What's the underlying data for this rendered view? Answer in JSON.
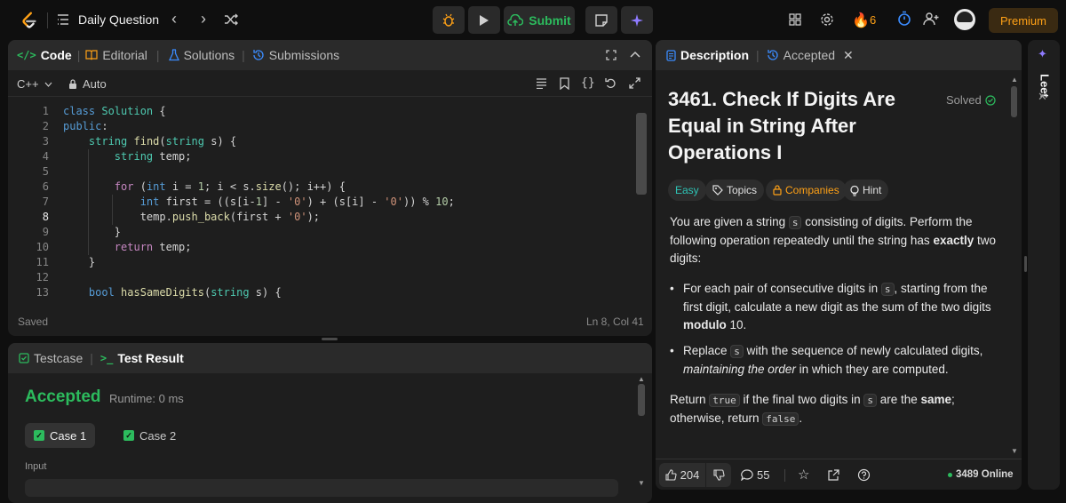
{
  "topbar": {
    "title": "Daily Question",
    "submit_label": "Submit",
    "streak_count": "6",
    "premium_label": "Premium"
  },
  "code_panel": {
    "tabs": [
      {
        "label": "Code"
      },
      {
        "label": "Editorial"
      },
      {
        "label": "Solutions"
      },
      {
        "label": "Submissions"
      }
    ],
    "language": "C++",
    "mode": "Auto",
    "status": "Saved",
    "cursor_pos": "Ln 8, Col 41",
    "lines": [
      {
        "n": "1",
        "text": "class Solution {"
      },
      {
        "n": "2",
        "text": "public:"
      },
      {
        "n": "3",
        "text": "    string find(string s) {"
      },
      {
        "n": "4",
        "text": "        string temp;"
      },
      {
        "n": "5",
        "text": ""
      },
      {
        "n": "6",
        "text": "        for (int i = 1; i < s.size(); i++) {"
      },
      {
        "n": "7",
        "text": "            int first = ((s[i-1] - '0') + (s[i] - '0')) % 10;"
      },
      {
        "n": "8",
        "text": "            temp.push_back(first + '0');"
      },
      {
        "n": "9",
        "text": "        }"
      },
      {
        "n": "10",
        "text": "        return temp;"
      },
      {
        "n": "11",
        "text": "    }"
      },
      {
        "n": "12",
        "text": ""
      },
      {
        "n": "13",
        "text": "    bool hasSameDigits(string s) {"
      }
    ]
  },
  "test_panel": {
    "tab_testcase": "Testcase",
    "tab_result": "Test Result",
    "verdict": "Accepted",
    "runtime": "Runtime: 0 ms",
    "case1": "Case 1",
    "case2": "Case 2",
    "input_label": "Input"
  },
  "desc_panel": {
    "tab_description": "Description",
    "tab_accepted": "Accepted",
    "title_line1": "3461. Check If Digits Are",
    "title_line2": "Equal in String After",
    "title_line3": "Operations I",
    "solved": "Solved",
    "tags": {
      "difficulty": "Easy",
      "topics": "Topics",
      "companies": "Companies",
      "hint": "Hint"
    },
    "p1_a": "You are given a string ",
    "p1_code": "s",
    "p1_b": " consisting of digits. Perform the following operation repeatedly until the string has ",
    "p1_bold": "exactly",
    "p1_c": " two digits:",
    "b1_a": "For each pair of consecutive digits in ",
    "b1_code": "s",
    "b1_b": ", starting from the first digit, calculate a new digit as the sum of the two digits ",
    "b1_bold": "modulo",
    "b1_c": " 10.",
    "b2_a": "Replace ",
    "b2_code": "s",
    "b2_b": " with the sequence of newly calculated digits, ",
    "b2_ital": "maintaining the order",
    "b2_c": " in which they are computed.",
    "p2_a": "Return ",
    "p2_code1": "true",
    "p2_b": " if the final two digits in ",
    "p2_code2": "s",
    "p2_c": " are the ",
    "p2_bold": "same",
    "p2_d": ";",
    "p2_e": "otherwise, return ",
    "p2_code3": "false",
    "p2_f": ".",
    "likes": "204",
    "comments": "55",
    "online": "3489 Online"
  },
  "side": {
    "label": "Leet"
  },
  "colors": {
    "accent_green": "#2cbb5d",
    "accent_orange": "#ffa116",
    "panel": "#1e1e1e",
    "header": "#2a2a2a"
  }
}
